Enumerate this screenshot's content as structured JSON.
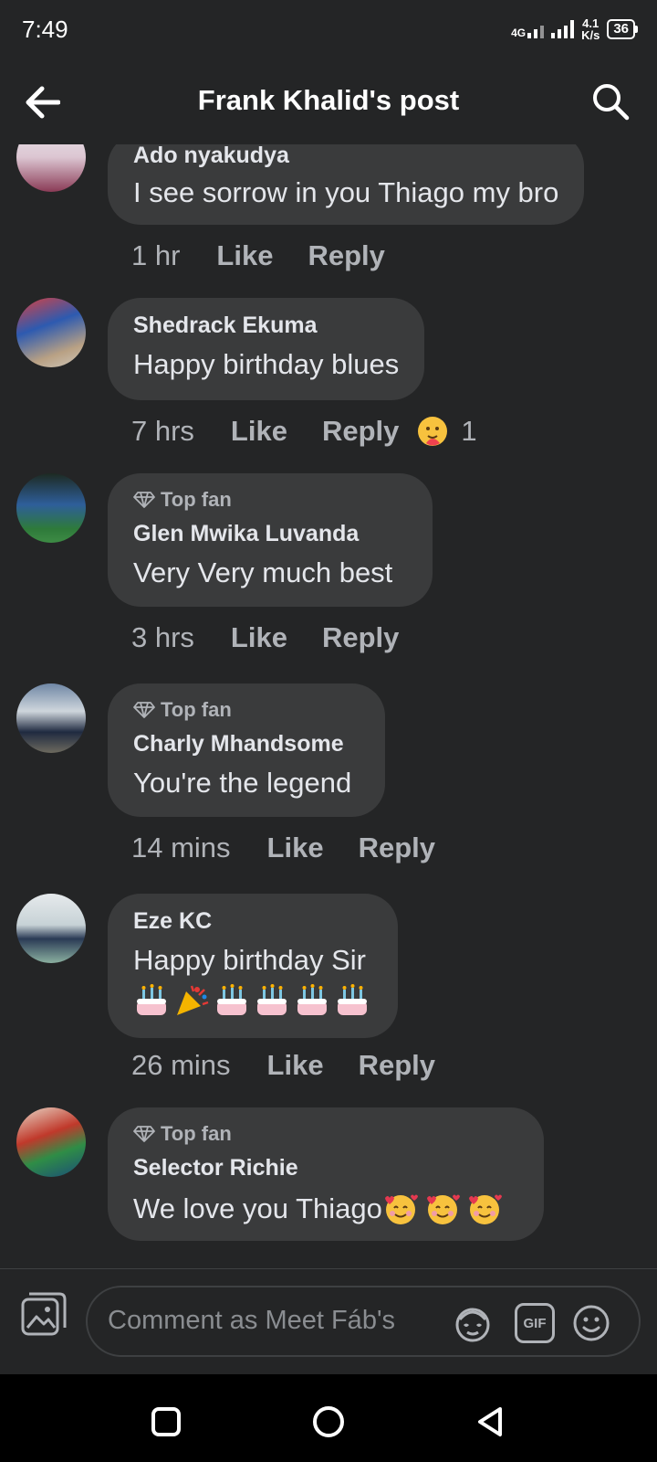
{
  "status_bar": {
    "time": "7:49",
    "network": "4G",
    "speed_value": "4.1",
    "speed_unit": "K/s",
    "battery": "36"
  },
  "header": {
    "title": "Frank Khalid's post",
    "back_icon": "arrow-left-icon",
    "search_icon": "search-icon"
  },
  "comments": [
    {
      "author": "Ado nyakudya",
      "text": "I see sorrow in you Thiago my bro",
      "time": "1 hr",
      "like": "Like",
      "reply": "Reply",
      "top_fan": "",
      "reaction_count": ""
    },
    {
      "author": "Shedrack Ekuma",
      "text": "Happy birthday blues",
      "time": "7 hrs",
      "like": "Like",
      "reply": "Reply",
      "top_fan": "",
      "reaction_count": "1",
      "reaction_icon": "care-reaction-icon"
    },
    {
      "author": "Glen Mwika Luvanda",
      "text": "Very Very much best",
      "time": "3 hrs",
      "like": "Like",
      "reply": "Reply",
      "top_fan": "Top fan",
      "reaction_count": ""
    },
    {
      "author": "Charly Mhandsome",
      "text": "You're the legend",
      "time": "14 mins",
      "like": "Like",
      "reply": "Reply",
      "top_fan": "Top fan",
      "reaction_count": ""
    },
    {
      "author": "Eze KC",
      "text": "Happy birthday Sir",
      "time": "26 mins",
      "like": "Like",
      "reply": "Reply",
      "top_fan": "",
      "reaction_count": "",
      "emojis": [
        "birthday-cake-icon",
        "party-popper-icon",
        "birthday-cake-icon",
        "birthday-cake-icon",
        "birthday-cake-icon",
        "birthday-cake-icon"
      ]
    },
    {
      "author": "Selector Richie",
      "text": "We love you Thiago",
      "time": "",
      "like": "",
      "reply": "",
      "top_fan": "Top fan",
      "reaction_count": "",
      "emojis": [
        "smiling-face-with-hearts-icon",
        "smiling-face-with-hearts-icon",
        "smiling-face-with-hearts-icon"
      ]
    }
  ],
  "composer": {
    "placeholder": "Comment as Meet Fáb's",
    "gif_label": "GIF"
  },
  "colors": {
    "background": "#242526",
    "bubble": "#3a3b3c",
    "text_primary": "#e4e6eb",
    "text_secondary": "#b0b3b8"
  }
}
